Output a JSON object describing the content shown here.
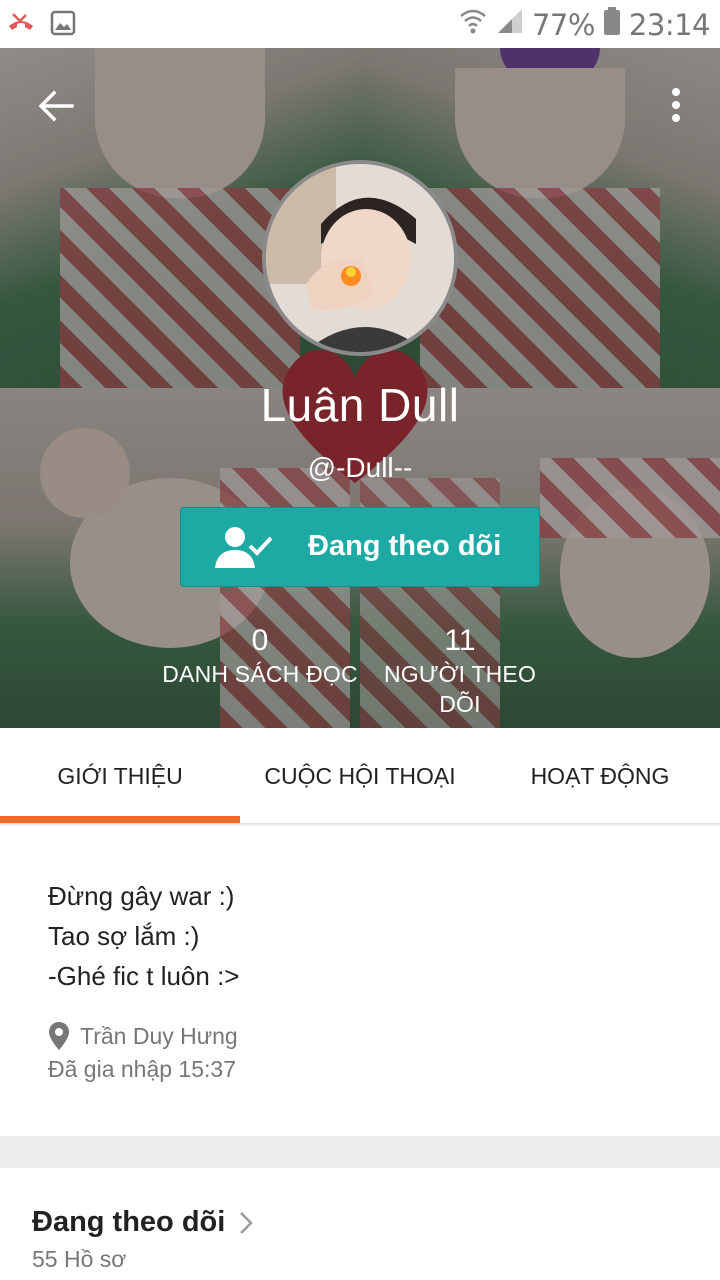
{
  "status_bar": {
    "battery": "77%",
    "time": "23:14",
    "icons": [
      "missed-call-icon",
      "image-icon",
      "wifi-icon",
      "signal-icon",
      "battery-icon"
    ]
  },
  "profile": {
    "name": "Luân Dull",
    "handle": "@-Dull--",
    "follow_label": "Đang theo dõi",
    "stats": [
      {
        "value": "0",
        "label": "DANH SÁCH ĐỌC"
      },
      {
        "value": "11",
        "label": "NGƯỜI THEO DÕI"
      }
    ]
  },
  "tabs": [
    {
      "label": "GIỚI THIỆU",
      "active": true
    },
    {
      "label": "CUỘC HỘI THOẠI",
      "active": false
    },
    {
      "label": "HOẠT ĐỘNG",
      "active": false
    }
  ],
  "about": {
    "bio_lines": [
      "Đừng gây war :)",
      "Tao sợ lắm :)",
      "-Ghé fic t luôn :>"
    ],
    "location": "Trần Duy Hưng",
    "joined": "Đã gia nhập 15:37"
  },
  "following_section": {
    "title": "Đang theo dõi",
    "subtitle": "55 Hồ sơ"
  },
  "colors": {
    "accent_teal": "#1eaaa4",
    "tab_indicator": "#f26c29"
  }
}
